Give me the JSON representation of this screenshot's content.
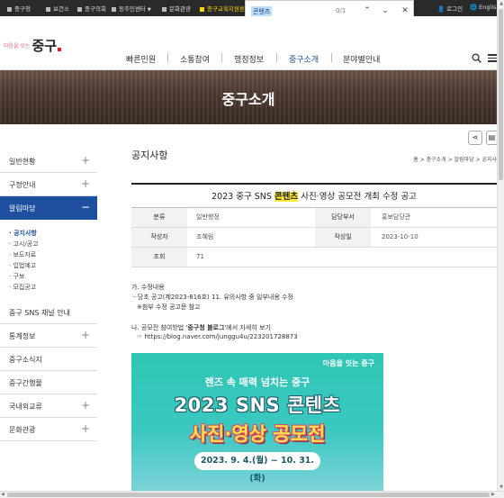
{
  "topbar": {
    "links": [
      "중구청",
      "보건소",
      "중구의회",
      "동주민센터",
      "문화관광",
      "중구교육지원센"
    ],
    "login": "로그인",
    "lang": "English"
  },
  "find": {
    "query": "콘텐츠",
    "count": "0/1"
  },
  "header": {
    "logo_small": "마음을 잇는",
    "logo_big": "중구",
    "nav": [
      "빠른민원",
      "소통참여",
      "행정정보",
      "중구소개",
      "분야별안내"
    ]
  },
  "banner": {
    "title": "중구소개"
  },
  "sidebar": {
    "items": [
      "일반현황",
      "구정안내",
      "알림마당",
      "중구 SNS 채널 안내",
      "통계정보",
      "중구소식지",
      "중구간행물",
      "국내외교류",
      "문화관광"
    ],
    "subitems": [
      "공지사항",
      "고시/공고",
      "보도자료",
      "입법예고",
      "구보",
      "모집공고"
    ]
  },
  "content": {
    "page_title": "공지사항",
    "breadcrumb": "홈 > 중구소개 > 알림마당 > 공지사",
    "post_title_before": "2023 중구 SNS ",
    "post_title_highlight": "콘텐츠",
    "post_title_after": " 사진·영상 공모전 개최 수정 공고",
    "meta": [
      {
        "k1": "분류",
        "v1": "일반행정",
        "k2": "담당부서",
        "v2": "홍보담당관"
      },
      {
        "k1": "작성자",
        "v1": "조혜림",
        "k2": "작성일",
        "v2": "2023-10-10"
      },
      {
        "k1": "조회",
        "v1": "71"
      }
    ],
    "body": [
      "가. 수정내용",
      "  - 당초 공고(제2023-816호) 11. 유의사항 중 일부내용 수정",
      "    ※첨부 수정 공고문 참고",
      "나. 공모전 참여방법 '중구청 블로그'에서 자세히 보기",
      "    ☞ https://blog.naver.com/junggu4u/223201728873"
    ],
    "body_bold": "중구청 블로그"
  },
  "poster": {
    "logo": "마음을 잇는 중구",
    "line1": "렌즈 속 매력 넘치는 중구",
    "line2": "2023 SNS 콘텐츠",
    "line3": "사진·영상 공모전",
    "date": "2023. 9. 4.(월) ~ 10. 31.(화)"
  }
}
